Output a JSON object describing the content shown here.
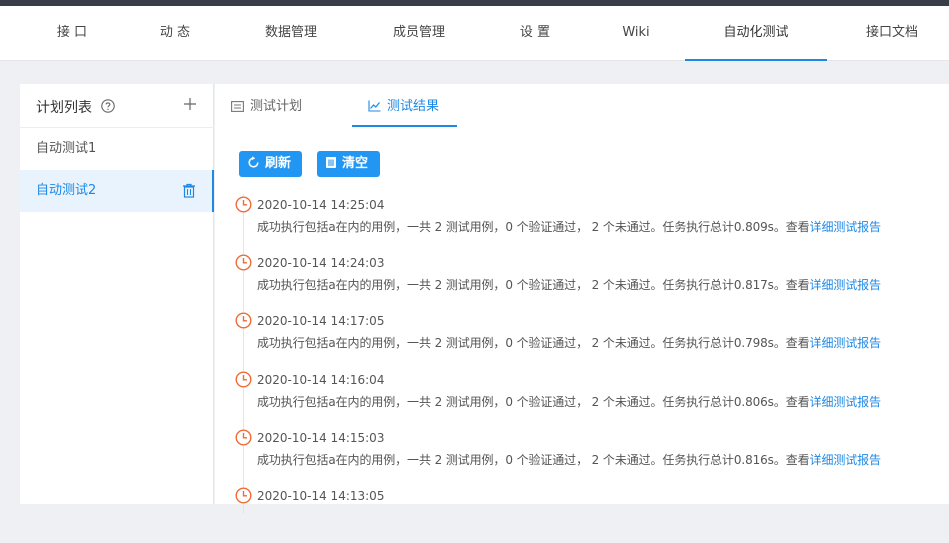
{
  "nav": {
    "items": [
      {
        "label": "接 口"
      },
      {
        "label": "动 态"
      },
      {
        "label": "数据管理"
      },
      {
        "label": "成员管理"
      },
      {
        "label": "设 置"
      },
      {
        "label": "Wiki"
      },
      {
        "label": "自动化测试"
      },
      {
        "label": "接口文档"
      }
    ],
    "active_index": 6
  },
  "sidebar": {
    "title": "计划列表",
    "items": [
      {
        "label": "自动测试1",
        "selected": false
      },
      {
        "label": "自动测试2",
        "selected": true
      }
    ]
  },
  "tabs": [
    {
      "label": "测试计划",
      "icon": "plan-icon"
    },
    {
      "label": "测试结果",
      "icon": "chart-line-icon",
      "active": true
    }
  ],
  "toolbar": {
    "refresh_label": "刷新",
    "clear_label": "清空"
  },
  "records": [
    {
      "time": "2020-10-14 14:25:04",
      "text": "成功执行包括a在内的用例，一共 2 测试用例，0 个验证通过， 2 个未通过。任务执行总计0.809s。查看",
      "link": "详细测试报告"
    },
    {
      "time": "2020-10-14 14:24:03",
      "text": "成功执行包括a在内的用例，一共 2 测试用例，0 个验证通过， 2 个未通过。任务执行总计0.817s。查看",
      "link": "详细测试报告"
    },
    {
      "time": "2020-10-14 14:17:05",
      "text": "成功执行包括a在内的用例，一共 2 测试用例，0 个验证通过， 2 个未通过。任务执行总计0.798s。查看",
      "link": "详细测试报告"
    },
    {
      "time": "2020-10-14 14:16:04",
      "text": "成功执行包括a在内的用例，一共 2 测试用例，0 个验证通过， 2 个未通过。任务执行总计0.806s。查看",
      "link": "详细测试报告"
    },
    {
      "time": "2020-10-14 14:15:03",
      "text": "成功执行包括a在内的用例，一共 2 测试用例，0 个验证通过， 2 个未通过。任务执行总计0.816s。查看",
      "link": "详细测试报告"
    },
    {
      "time": "2020-10-14 14:13:05",
      "text": "",
      "link": ""
    }
  ],
  "colors": {
    "accent": "#1e88e5",
    "button": "#2196f3",
    "clock": "#f06a35",
    "topbar": "#393d49"
  }
}
